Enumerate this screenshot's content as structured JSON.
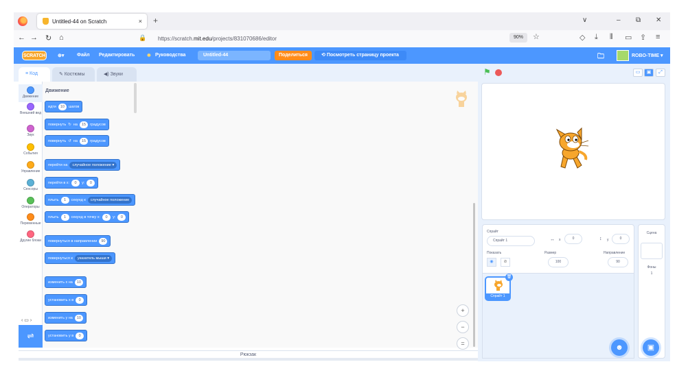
{
  "browser": {
    "tab_title": "Untitled-44 on Scratch",
    "new_tab": "+",
    "tab_close": "×",
    "url_host": "https://scratch.",
    "url_domain": "mit.edu",
    "url_path": "/projects/831070686/editor",
    "zoom": "90%",
    "minimize": "–",
    "restore": "⧉",
    "close": "✕",
    "dropdown": "∨"
  },
  "menubar": {
    "logo": "SCRATCH",
    "file": "Файл",
    "edit": "Редактировать",
    "tutorials": "Руководства",
    "project_title": "Untitled-44",
    "share": "Поделиться",
    "see_project": "Посмотреть страницу проекта",
    "user": "ROBO-TIME ▾",
    "globe": "⊕▾"
  },
  "tabs": {
    "code": "Код",
    "costumes": "Костюмы",
    "sounds": "Звуки"
  },
  "categories": [
    {
      "label": "Движение",
      "color": "#4c97ff"
    },
    {
      "label": "Внешний вид",
      "color": "#9966ff"
    },
    {
      "label": "Звук",
      "color": "#cf63cf"
    },
    {
      "label": "События",
      "color": "#ffbf00"
    },
    {
      "label": "Управление",
      "color": "#ffab19"
    },
    {
      "label": "Сенсоры",
      "color": "#5cb1d6"
    },
    {
      "label": "Операторы",
      "color": "#59c059"
    },
    {
      "label": "Переменные",
      "color": "#ff8c1a"
    },
    {
      "label": "Другие блоки",
      "color": "#ff6680"
    }
  ],
  "palette": {
    "section_title": "Движение",
    "blocks": {
      "move": {
        "a": "идти",
        "v": "10",
        "b": "шагов"
      },
      "turn_right": {
        "a": "повернуть",
        "b": "на",
        "v": "15",
        "c": "градусов"
      },
      "turn_left": {
        "a": "повернуть",
        "b": "на",
        "v": "15",
        "c": "градусов"
      },
      "goto": {
        "a": "перейти на",
        "dd": "случайное положение ▾"
      },
      "goto_xy": {
        "a": "перейти в x:",
        "x": "0",
        "b": "y:",
        "y": "0"
      },
      "glide_to": {
        "a": "плыть",
        "v": "1",
        "b": "секунд к",
        "dd": "случайное положение"
      },
      "glide_xy": {
        "a": "плыть",
        "v": "1",
        "b": "секунд в точку x:",
        "x": "0",
        "c": "y:",
        "y": "0"
      },
      "point_dir": {
        "a": "повернуться в направлении",
        "v": "90"
      },
      "point_to": {
        "a": "повернуться к",
        "dd": "указатель мыши ▾"
      },
      "change_x": {
        "a": "изменить х на",
        "v": "10"
      },
      "set_x": {
        "a": "установить х в",
        "v": "0"
      },
      "change_y": {
        "a": "изменить у на",
        "v": "10"
      },
      "set_y": {
        "a": "установить у в",
        "v": "0"
      }
    }
  },
  "workspace": {
    "backpack": "Рюкзак",
    "zoom_in": "+",
    "zoom_out": "−",
    "zoom_reset": "="
  },
  "sprite_info": {
    "sprite_label": "Спрайт",
    "sprite_name": "Спрайт 1",
    "x_label": "x",
    "x_value": "0",
    "y_label": "y",
    "y_value": "0",
    "show_label": "Показать",
    "size_label": "Размер",
    "size_value": "100",
    "direction_label": "Направление",
    "direction_value": "90"
  },
  "sprite_list": {
    "card_label": "Спрайт 1"
  },
  "stage_panel": {
    "title": "Сцена",
    "backdrops_label": "Фоны",
    "backdrops_count": "1"
  }
}
